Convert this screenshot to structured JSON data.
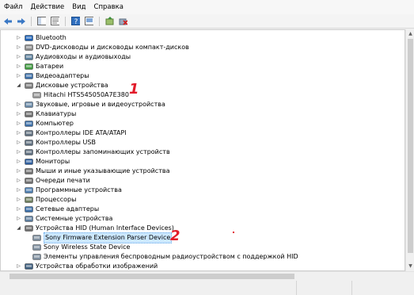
{
  "menu": [
    "Файл",
    "Действие",
    "Вид",
    "Справка"
  ],
  "toolbar": {
    "buttons": [
      "back-arrow-icon",
      "forward-arrow-icon",
      "show-hide-console-tree-icon",
      "properties-icon",
      "help-icon",
      "device-manager-view-icon",
      "update-driver-icon",
      "uninstall-icon"
    ]
  },
  "tree": [
    {
      "label": "Bluetooth",
      "level": 1,
      "expanded": false,
      "icon": "bluetooth-icon"
    },
    {
      "label": "DVD-дисководы и дисководы компакт-дисков",
      "level": 1,
      "expanded": false,
      "icon": "dvd-drive-icon"
    },
    {
      "label": "Аудиовходы и аудиовыходы",
      "level": 1,
      "expanded": false,
      "icon": "audio-icon"
    },
    {
      "label": "Батареи",
      "level": 1,
      "expanded": false,
      "icon": "battery-icon"
    },
    {
      "label": "Видеоадаптеры",
      "level": 1,
      "expanded": false,
      "icon": "display-adapter-icon"
    },
    {
      "label": "Дисковые устройства",
      "level": 1,
      "expanded": true,
      "icon": "disk-drive-icon"
    },
    {
      "label": "Hitachi HTS545050A7E380",
      "level": 2,
      "expanded": null,
      "icon": "hard-disk-icon"
    },
    {
      "label": "Звуковые, игровые и видеоустройства",
      "level": 1,
      "expanded": false,
      "icon": "sound-icon"
    },
    {
      "label": "Клавиатуры",
      "level": 1,
      "expanded": false,
      "icon": "keyboard-icon"
    },
    {
      "label": "Компьютер",
      "level": 1,
      "expanded": false,
      "icon": "computer-icon"
    },
    {
      "label": "Контроллеры IDE ATA/ATAPI",
      "level": 1,
      "expanded": false,
      "icon": "ide-controller-icon"
    },
    {
      "label": "Контроллеры USB",
      "level": 1,
      "expanded": false,
      "icon": "usb-controller-icon"
    },
    {
      "label": "Контроллеры запоминающих устройств",
      "level": 1,
      "expanded": false,
      "icon": "storage-controller-icon"
    },
    {
      "label": "Мониторы",
      "level": 1,
      "expanded": false,
      "icon": "monitor-icon"
    },
    {
      "label": "Мыши и иные указывающие устройства",
      "level": 1,
      "expanded": false,
      "icon": "mouse-icon"
    },
    {
      "label": "Очереди печати",
      "level": 1,
      "expanded": false,
      "icon": "print-queue-icon"
    },
    {
      "label": "Программные устройства",
      "level": 1,
      "expanded": false,
      "icon": "software-device-icon"
    },
    {
      "label": "Процессоры",
      "level": 1,
      "expanded": false,
      "icon": "processor-icon"
    },
    {
      "label": "Сетевые адаптеры",
      "level": 1,
      "expanded": false,
      "icon": "network-adapter-icon"
    },
    {
      "label": "Системные устройства",
      "level": 1,
      "expanded": false,
      "icon": "system-device-icon"
    },
    {
      "label": "Устройства HID (Human Interface Devices)",
      "level": 1,
      "expanded": true,
      "icon": "hid-icon"
    },
    {
      "label": "Sony Firmware Extension Parser Device",
      "level": 2,
      "expanded": null,
      "icon": "hid-device-icon",
      "selected": true
    },
    {
      "label": "Sony Wireless State Device",
      "level": 2,
      "expanded": null,
      "icon": "hid-device-icon"
    },
    {
      "label": "Элементы управления беспроводным радиоустройством с поддержкой HID",
      "level": 2,
      "expanded": null,
      "icon": "hid-device-icon"
    },
    {
      "label": "Устройства обработки изображений",
      "level": 1,
      "expanded": false,
      "icon": "imaging-device-icon"
    }
  ],
  "annotations": [
    "1",
    "2"
  ],
  "colors": {
    "selection": "#cce8ff",
    "annotation": "#e21b2a"
  }
}
